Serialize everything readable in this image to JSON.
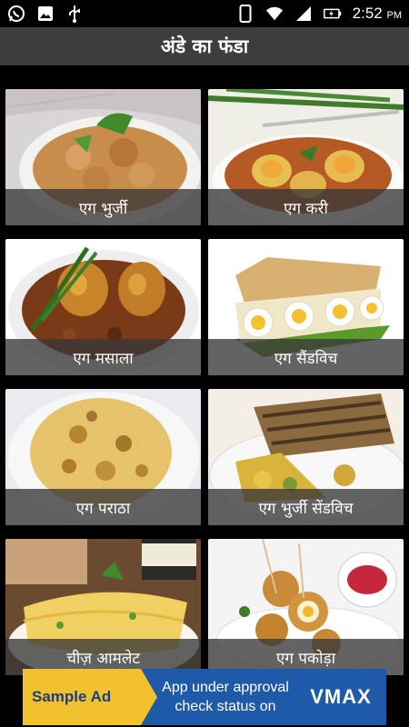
{
  "status_bar": {
    "time": "2:52",
    "ampm": "PM",
    "left_icons": [
      "whatsapp-icon",
      "image-icon",
      "usb-icon"
    ],
    "right_icons": [
      "phone-icon",
      "wifi-icon",
      "cell-signal-icon",
      "battery-charging-icon"
    ]
  },
  "app_bar": {
    "title": "अंडे का फंडा"
  },
  "recipes": [
    {
      "label": "एग भुर्जी"
    },
    {
      "label": "एग करी"
    },
    {
      "label": "एग मसाला"
    },
    {
      "label": "एग सैंडविच"
    },
    {
      "label": "एग पराठा"
    },
    {
      "label": "एग भुर्जी सेंडविच"
    },
    {
      "label": "चीज़ आमलेट"
    },
    {
      "label": "एग पकोड़ा"
    }
  ],
  "ad": {
    "tag": "Sample Ad",
    "line1": "App under approval",
    "line2": "check status on",
    "brand": "VMAX"
  },
  "colors": {
    "app_bar": "#3d3d3d",
    "ad_background": "#1f5aa8",
    "ad_tag": "#f2c12e"
  }
}
